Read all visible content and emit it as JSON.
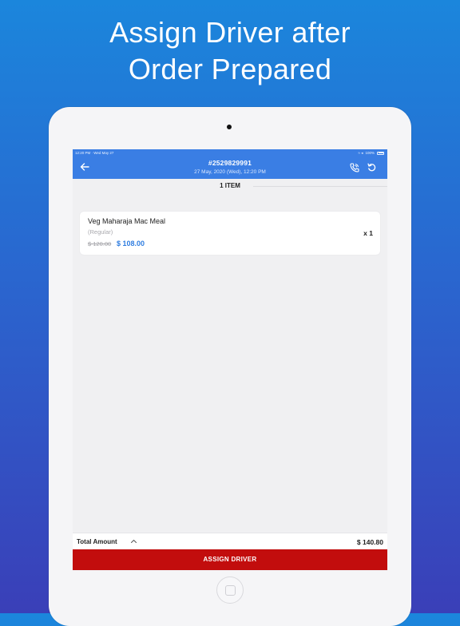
{
  "headline": {
    "line1": "Assign Driver after",
    "line2": "Order Prepared"
  },
  "status_bar": {
    "left": "12:20 PM · Wed May 27",
    "signal": "≈ ◂",
    "battery_pct": "100%"
  },
  "header": {
    "order_number": "#2529829991",
    "order_datetime": "27 May, 2020 (Wed), 12:20 PM"
  },
  "items_summary": {
    "count_label": "1 ITEM"
  },
  "items": [
    {
      "name": "Veg Maharaja Mac Meal",
      "variant": "(Regular)",
      "old_price": "$ 120.00",
      "price": "$ 108.00",
      "quantity": "x 1"
    }
  ],
  "footer": {
    "total_label": "Total Amount",
    "total_value": "$ 140.80",
    "assign_button_label": "ASSIGN DRIVER"
  },
  "colors": {
    "header_blue": "#3a7ee4",
    "price_blue": "#2f7de0",
    "assign_red": "#c20d0d"
  },
  "icons": [
    "back-arrow-icon",
    "phone-call-icon",
    "refresh-icon",
    "chevron-up-icon"
  ]
}
